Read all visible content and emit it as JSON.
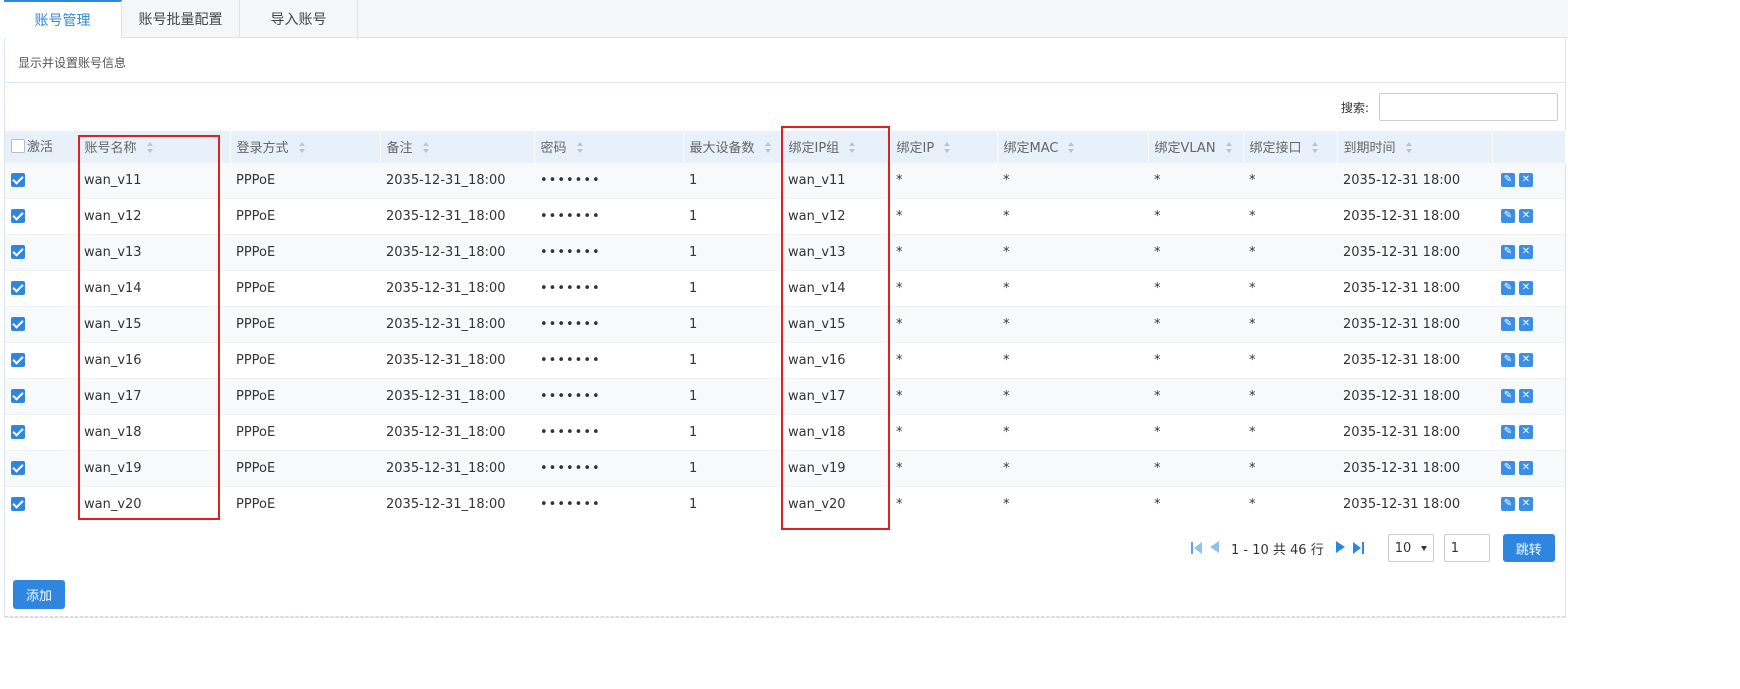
{
  "tabs": [
    {
      "label": "账号管理",
      "active": true
    },
    {
      "label": "账号批量配置",
      "active": false
    },
    {
      "label": "导入账号",
      "active": false
    }
  ],
  "panel": {
    "description": "显示并设置账号信息",
    "search_label": "搜索:",
    "search_value": ""
  },
  "table": {
    "columns": [
      "激活",
      "账号名称",
      "登录方式",
      "备注",
      "密码",
      "最大设备数",
      "绑定IP组",
      "绑定IP",
      "绑定MAC",
      "绑定VLAN",
      "绑定接口",
      "到期时间"
    ],
    "rows": [
      {
        "active": true,
        "name": "wan_v11",
        "login": "PPPoE",
        "note": "2035-12-31_18:00",
        "password": "•••••••",
        "max_devices": "1",
        "ip_group": "wan_v11",
        "ip": "*",
        "mac": "*",
        "vlan": "*",
        "iface": "*",
        "expire": "2035-12-31 18:00"
      },
      {
        "active": true,
        "name": "wan_v12",
        "login": "PPPoE",
        "note": "2035-12-31_18:00",
        "password": "•••••••",
        "max_devices": "1",
        "ip_group": "wan_v12",
        "ip": "*",
        "mac": "*",
        "vlan": "*",
        "iface": "*",
        "expire": "2035-12-31 18:00"
      },
      {
        "active": true,
        "name": "wan_v13",
        "login": "PPPoE",
        "note": "2035-12-31_18:00",
        "password": "•••••••",
        "max_devices": "1",
        "ip_group": "wan_v13",
        "ip": "*",
        "mac": "*",
        "vlan": "*",
        "iface": "*",
        "expire": "2035-12-31 18:00"
      },
      {
        "active": true,
        "name": "wan_v14",
        "login": "PPPoE",
        "note": "2035-12-31_18:00",
        "password": "•••••••",
        "max_devices": "1",
        "ip_group": "wan_v14",
        "ip": "*",
        "mac": "*",
        "vlan": "*",
        "iface": "*",
        "expire": "2035-12-31 18:00"
      },
      {
        "active": true,
        "name": "wan_v15",
        "login": "PPPoE",
        "note": "2035-12-31_18:00",
        "password": "•••••••",
        "max_devices": "1",
        "ip_group": "wan_v15",
        "ip": "*",
        "mac": "*",
        "vlan": "*",
        "iface": "*",
        "expire": "2035-12-31 18:00"
      },
      {
        "active": true,
        "name": "wan_v16",
        "login": "PPPoE",
        "note": "2035-12-31_18:00",
        "password": "•••••••",
        "max_devices": "1",
        "ip_group": "wan_v16",
        "ip": "*",
        "mac": "*",
        "vlan": "*",
        "iface": "*",
        "expire": "2035-12-31 18:00"
      },
      {
        "active": true,
        "name": "wan_v17",
        "login": "PPPoE",
        "note": "2035-12-31_18:00",
        "password": "•••••••",
        "max_devices": "1",
        "ip_group": "wan_v17",
        "ip": "*",
        "mac": "*",
        "vlan": "*",
        "iface": "*",
        "expire": "2035-12-31 18:00"
      },
      {
        "active": true,
        "name": "wan_v18",
        "login": "PPPoE",
        "note": "2035-12-31_18:00",
        "password": "•••••••",
        "max_devices": "1",
        "ip_group": "wan_v18",
        "ip": "*",
        "mac": "*",
        "vlan": "*",
        "iface": "*",
        "expire": "2035-12-31 18:00"
      },
      {
        "active": true,
        "name": "wan_v19",
        "login": "PPPoE",
        "note": "2035-12-31_18:00",
        "password": "•••••••",
        "max_devices": "1",
        "ip_group": "wan_v19",
        "ip": "*",
        "mac": "*",
        "vlan": "*",
        "iface": "*",
        "expire": "2035-12-31 18:00"
      },
      {
        "active": true,
        "name": "wan_v20",
        "login": "PPPoE",
        "note": "2035-12-31_18:00",
        "password": "•••••••",
        "max_devices": "1",
        "ip_group": "wan_v20",
        "ip": "*",
        "mac": "*",
        "vlan": "*",
        "iface": "*",
        "expire": "2035-12-31 18:00"
      }
    ],
    "row_actions": {
      "edit_icon": "pencil-icon",
      "delete_icon": "close-icon"
    }
  },
  "pager": {
    "info": "1 - 10 共 46 行",
    "page_size": "10",
    "page": "1",
    "go_label": "跳转"
  },
  "add_label": "添加",
  "colors": {
    "accent": "#2e86de",
    "header_bg": "#e8f1fa",
    "annotation": "#e02020"
  }
}
